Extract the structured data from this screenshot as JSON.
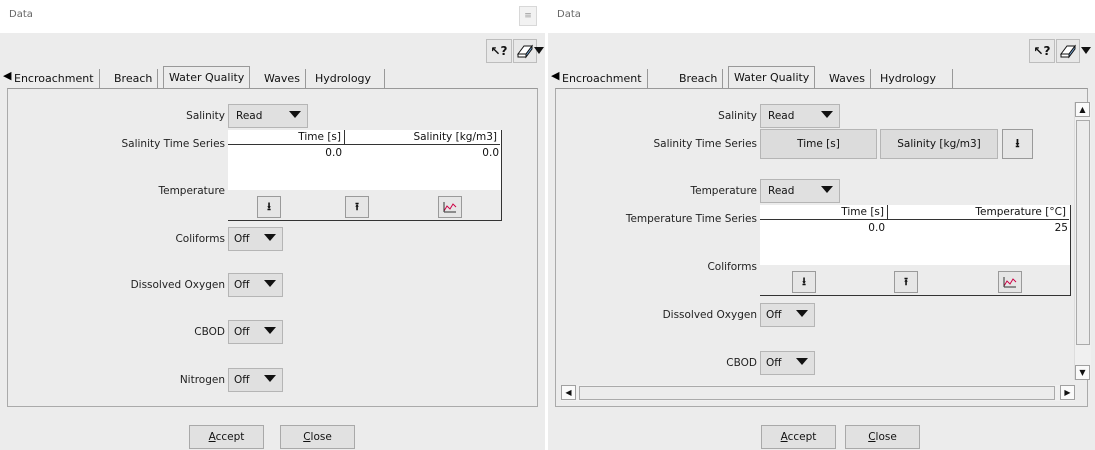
{
  "window1": {
    "title": "Data",
    "winbtn": "≡",
    "help_icon": "?",
    "tabs": [
      "Encroachment",
      "Breach",
      "Water Quality",
      "Waves",
      "Hydrology"
    ],
    "fields": {
      "salinity_label": "Salinity",
      "salinity_value": "Read",
      "salinity_ts_label": "Salinity Time Series",
      "ts_col1": "Time [s]",
      "ts_col2": "Salinity [kg/m3]",
      "ts_val1": "0.0",
      "ts_val2": "0.0",
      "temperature_label": "Temperature",
      "coliforms_label": "Coliforms",
      "coliforms_value": "Off",
      "do_label": "Dissolved Oxygen",
      "do_value": "Off",
      "cbod_label": "CBOD",
      "cbod_value": "Off",
      "nitrogen_label": "Nitrogen",
      "nitrogen_value": "Off"
    },
    "accept_label": "Accept",
    "close_label": "Close"
  },
  "window2": {
    "title": "Data",
    "tabs": [
      "Encroachment",
      "Breach",
      "Water Quality",
      "Waves",
      "Hydrology"
    ],
    "fields": {
      "salinity_label": "Salinity",
      "salinity_value": "Read",
      "salinity_ts_label": "Salinity Time Series",
      "time_btn": "Time [s]",
      "salinity_btn": "Salinity [kg/m3]",
      "temperature_label": "Temperature",
      "temperature_value": "Read",
      "temp_ts_label": "Temperature Time Series",
      "ts_col1": "Time [s]",
      "ts_col2": "Temperature [°C]",
      "ts_val1": "0.0",
      "ts_val2": "25",
      "coliforms_label": "Coliforms",
      "do_label": "Dissolved Oxygen",
      "do_value": "Off",
      "cbod_label": "CBOD",
      "cbod_value": "Off"
    },
    "accept_label": "Accept",
    "close_label": "Close"
  }
}
